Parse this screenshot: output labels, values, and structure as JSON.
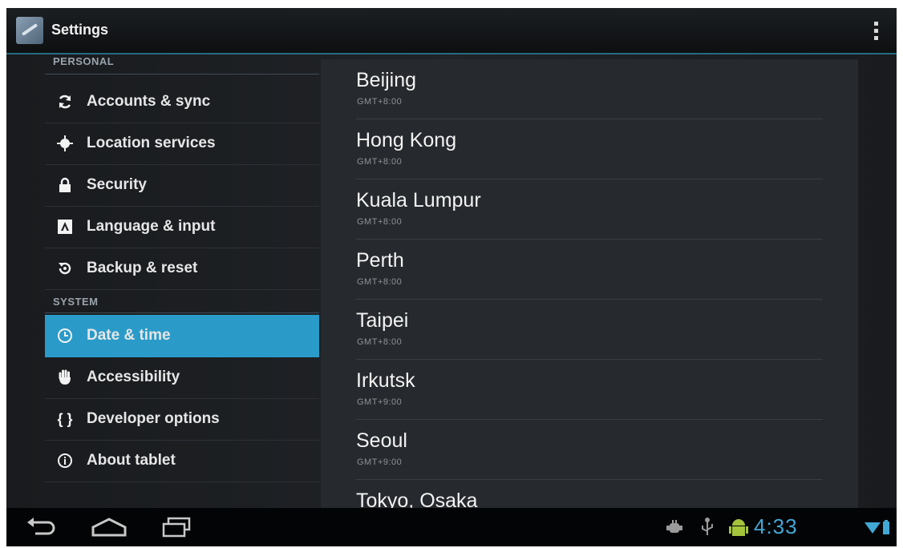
{
  "app": {
    "title": "Settings",
    "icon": "settings-icon",
    "overflow_icon": "overflow-menu-icon"
  },
  "sidebar": {
    "personal_header": "PERSONAL",
    "system_header": "SYSTEM",
    "personal_items": [
      {
        "label": "Accounts & sync",
        "icon": "sync-icon"
      },
      {
        "label": "Location services",
        "icon": "location-icon"
      },
      {
        "label": "Security",
        "icon": "lock-icon"
      },
      {
        "label": "Language & input",
        "icon": "keyboard-icon"
      },
      {
        "label": "Backup & reset",
        "icon": "backup-icon"
      }
    ],
    "system_items": [
      {
        "label": "Date & time",
        "icon": "clock-icon",
        "selected": true
      },
      {
        "label": "Accessibility",
        "icon": "hand-icon"
      },
      {
        "label": "Developer options",
        "icon": "braces-icon",
        "glyph": "{ }"
      },
      {
        "label": "About tablet",
        "icon": "info-icon"
      }
    ]
  },
  "timezones": [
    {
      "name": "Beijing",
      "offset": "GMT+8:00"
    },
    {
      "name": "Hong Kong",
      "offset": "GMT+8:00"
    },
    {
      "name": "Kuala Lumpur",
      "offset": "GMT+8:00"
    },
    {
      "name": "Perth",
      "offset": "GMT+8:00"
    },
    {
      "name": "Taipei",
      "offset": "GMT+8:00"
    },
    {
      "name": "Irkutsk",
      "offset": "GMT+9:00"
    },
    {
      "name": "Seoul",
      "offset": "GMT+9:00"
    },
    {
      "name": "Tokyo, Osaka",
      "offset": ""
    }
  ],
  "navbar": {
    "back_icon": "back-icon",
    "home_icon": "home-icon",
    "recents_icon": "recent-apps-icon",
    "status_icons": [
      "usb-debug-icon",
      "usb-icon",
      "android-icon",
      "wifi-icon",
      "battery-icon"
    ],
    "time": "4:33"
  },
  "colors": {
    "accent": "#2a9bc9",
    "clock": "#42a8d6",
    "background": "#141618"
  }
}
